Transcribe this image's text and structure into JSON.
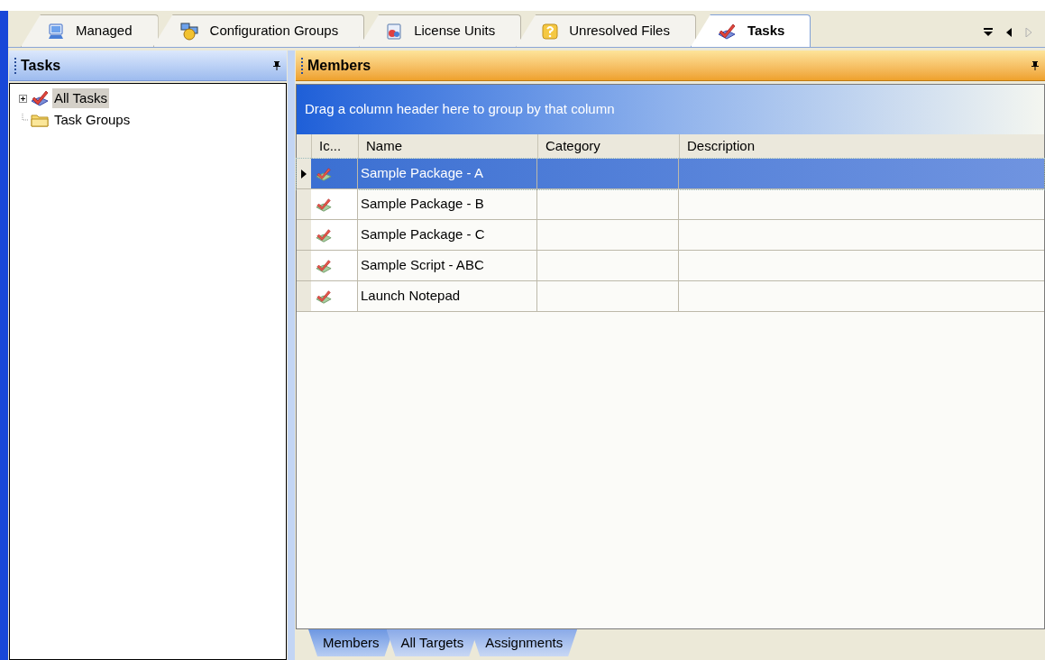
{
  "document_tabs": [
    {
      "label": "Managed",
      "kind": "monitor",
      "selected": false
    },
    {
      "label": "Configuration Groups",
      "kind": "groups",
      "selected": false
    },
    {
      "label": "License Units",
      "kind": "license",
      "selected": false
    },
    {
      "label": "Unresolved Files",
      "kind": "question",
      "selected": false
    },
    {
      "label": "Tasks",
      "kind": "task",
      "selected": true
    }
  ],
  "left_panel": {
    "title": "Tasks",
    "tree": [
      {
        "label": "All Tasks",
        "kind": "task",
        "selected": true,
        "expanded": false,
        "has_children": true
      },
      {
        "label": "Task Groups",
        "kind": "folder",
        "selected": false,
        "has_children": false
      }
    ]
  },
  "right_panel": {
    "title": "Members",
    "group_by_hint": "Drag a column header here to group by that column",
    "columns": [
      "Ic...",
      "Name",
      "Category",
      "Description"
    ],
    "rows": [
      {
        "name": "Sample Package - A",
        "selected": true
      },
      {
        "name": "Sample Package - B",
        "selected": false
      },
      {
        "name": "Sample Package - C",
        "selected": false
      },
      {
        "name": "Sample Script - ABC",
        "selected": false
      },
      {
        "name": "Launch Notepad",
        "selected": false
      }
    ],
    "bottom_tabs": [
      {
        "label": "Members",
        "selected": true
      },
      {
        "label": "All Targets",
        "selected": false
      },
      {
        "label": "Assignments",
        "selected": false
      }
    ]
  }
}
